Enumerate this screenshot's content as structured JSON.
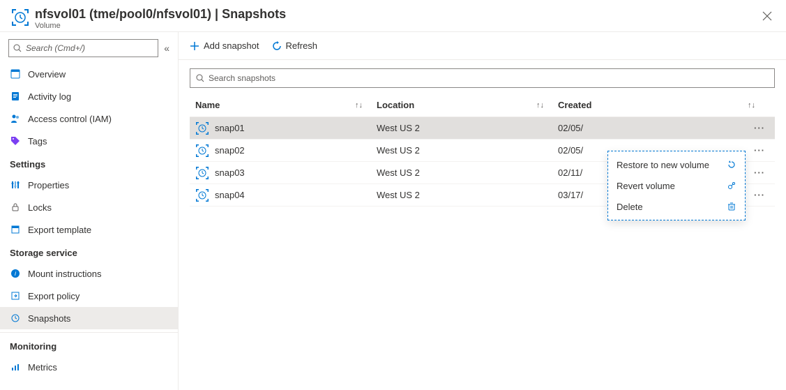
{
  "header": {
    "title": "nfsvol01 (tme/pool0/nfsvol01) | Snapshots",
    "subtitle": "Volume"
  },
  "sidebar": {
    "search_placeholder": "Search (Cmd+/)",
    "items": [
      {
        "label": "Overview"
      },
      {
        "label": "Activity log"
      },
      {
        "label": "Access control (IAM)"
      },
      {
        "label": "Tags"
      }
    ],
    "groups": [
      {
        "title": "Settings",
        "items": [
          {
            "label": "Properties"
          },
          {
            "label": "Locks"
          },
          {
            "label": "Export template"
          }
        ]
      },
      {
        "title": "Storage service",
        "items": [
          {
            "label": "Mount instructions"
          },
          {
            "label": "Export policy"
          },
          {
            "label": "Snapshots",
            "active": true
          }
        ]
      },
      {
        "title": "Monitoring",
        "items": [
          {
            "label": "Metrics"
          }
        ]
      }
    ]
  },
  "toolbar": {
    "add": "Add snapshot",
    "refresh": "Refresh"
  },
  "table": {
    "search_placeholder": "Search snapshots",
    "columns": {
      "name": "Name",
      "location": "Location",
      "created": "Created"
    },
    "rows": [
      {
        "name": "snap01",
        "location": "West US 2",
        "created": "02/05/"
      },
      {
        "name": "snap02",
        "location": "West US 2",
        "created": "02/05/"
      },
      {
        "name": "snap03",
        "location": "West US 2",
        "created": "02/11/"
      },
      {
        "name": "snap04",
        "location": "West US 2",
        "created": "03/17/"
      }
    ]
  },
  "context_menu": {
    "restore": "Restore to new volume",
    "revert": "Revert volume",
    "delete": "Delete"
  }
}
